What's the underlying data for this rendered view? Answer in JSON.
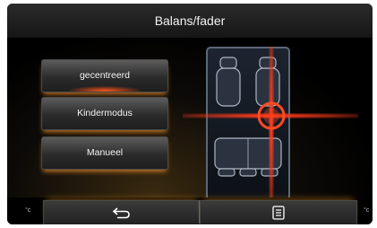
{
  "screen": {
    "title": "Balans/fader"
  },
  "modes": [
    {
      "label": "gecentreerd",
      "selected": true
    },
    {
      "label": "Kindermodus",
      "selected": false
    },
    {
      "label": "Manueel",
      "selected": false
    }
  ],
  "bottom": {
    "unit_left": "°c",
    "unit_right": "°c",
    "back_icon": "back-arrow-icon",
    "menu_icon": "menu-list-icon"
  },
  "colors": {
    "accent": "#e24a1c",
    "glow": "#f08a2a",
    "background": "#000000"
  }
}
